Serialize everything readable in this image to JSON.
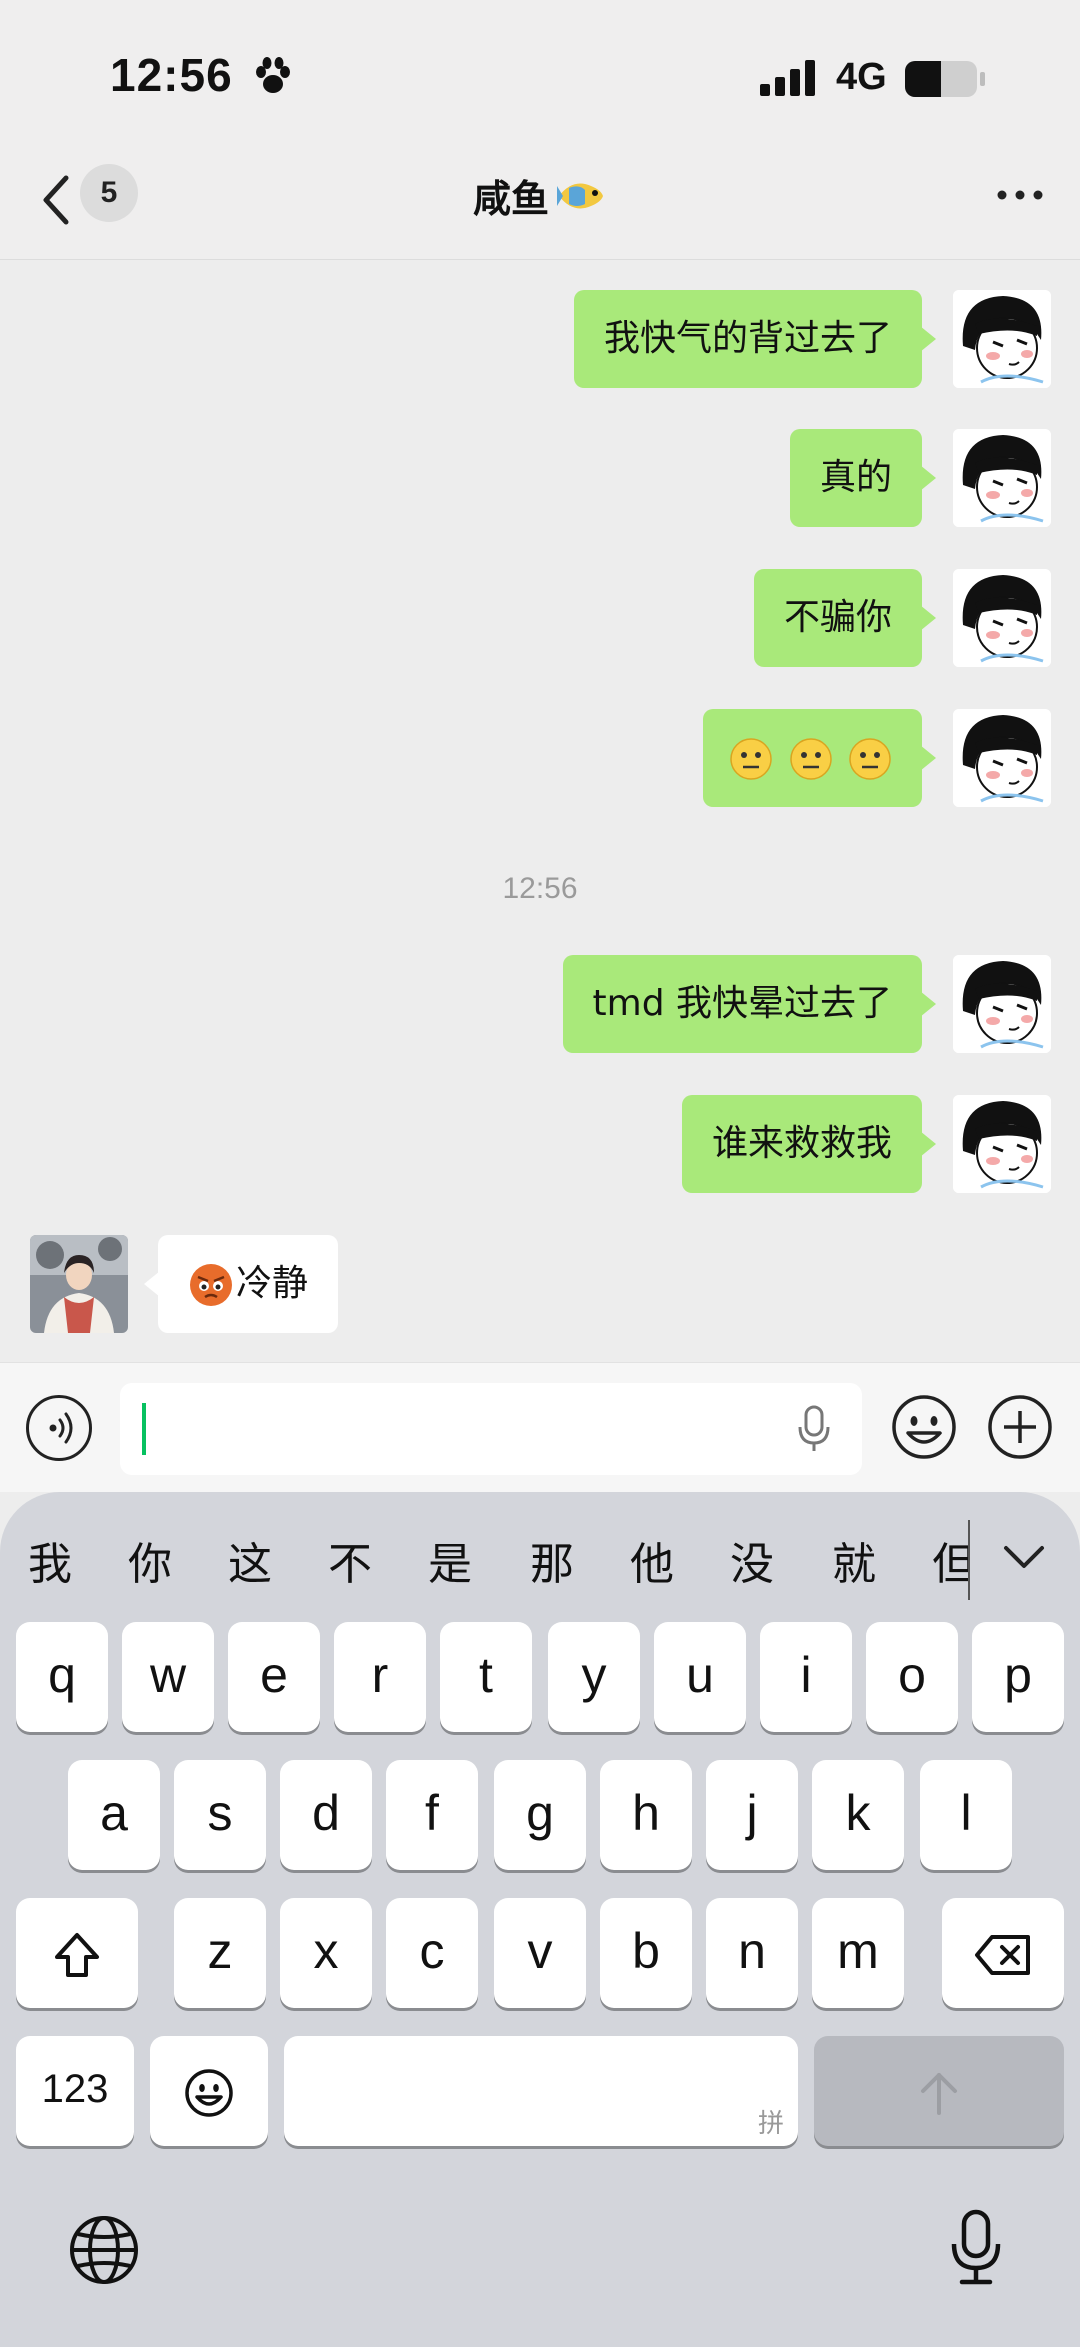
{
  "status_bar": {
    "time": "12:56",
    "network": "4G"
  },
  "nav": {
    "unread_count": "5",
    "title": "咸鱼"
  },
  "messages": [
    {
      "side": "out",
      "text": "我快气的背过去了"
    },
    {
      "side": "out",
      "text": "真的"
    },
    {
      "side": "out",
      "text": "不骗你"
    },
    {
      "side": "out",
      "text": "😶😶😶"
    },
    {
      "side": "out",
      "text": "tmd 我快晕过去了"
    },
    {
      "side": "out",
      "text": "谁来救救我"
    },
    {
      "side": "in",
      "text": "冷静"
    }
  ],
  "timestamp": "12:56",
  "input": {
    "value": ""
  },
  "keyboard": {
    "candidates": [
      "我",
      "你",
      "这",
      "不",
      "是",
      "那",
      "他",
      "没",
      "就",
      "但"
    ],
    "row1": [
      "q",
      "w",
      "e",
      "r",
      "t",
      "y",
      "u",
      "i",
      "o",
      "p"
    ],
    "row2": [
      "a",
      "s",
      "d",
      "f",
      "g",
      "h",
      "j",
      "k",
      "l"
    ],
    "row3": [
      "z",
      "x",
      "c",
      "v",
      "b",
      "n",
      "m"
    ],
    "numbers_key": "123",
    "space_hint": "拼"
  },
  "colors": {
    "outgoing_bubble": "#a9e97a",
    "incoming_bubble": "#ffffff",
    "caret": "#07c160"
  }
}
